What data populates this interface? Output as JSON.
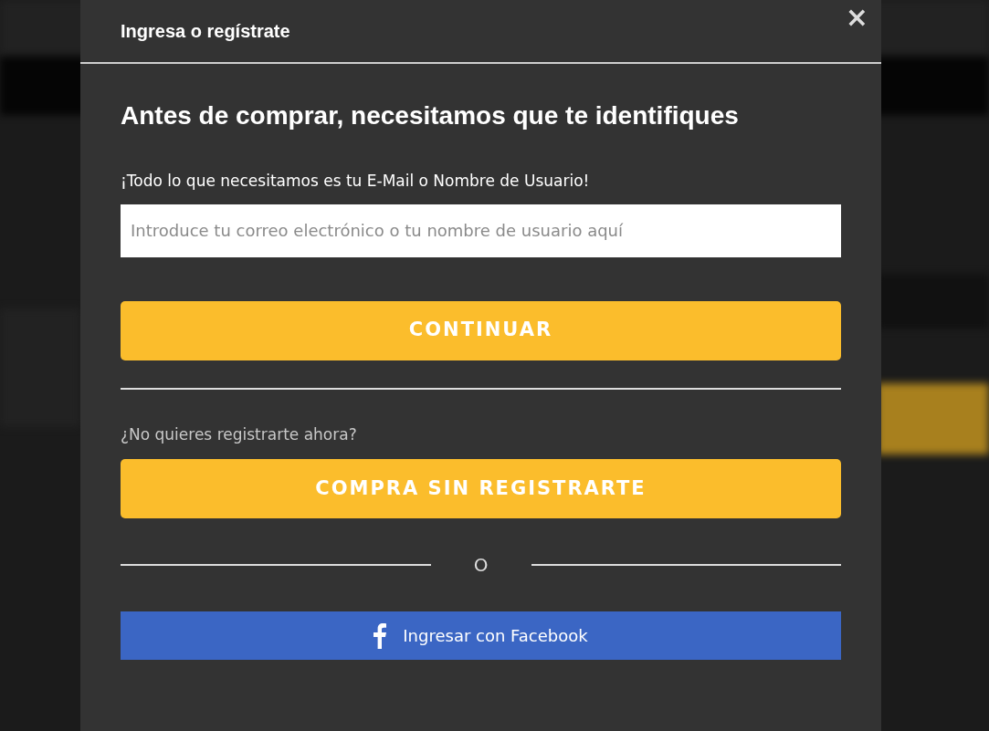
{
  "modal": {
    "title": "Ingresa o regístrate",
    "close": "×",
    "heading": "Antes de comprar, necesitamos que te identifiques",
    "prompt": "¡Todo lo que necesitamos es tu E-Mail o Nombre de Usuario!",
    "field": {
      "placeholder": "Introduce tu correo electrónico o tu nombre de usuario aquí"
    },
    "continue_button": "CONTINUAR",
    "guest_prompt": "¿No quieres registrarte ahora?",
    "guest_button": "COMPRA SIN REGISTRARTE",
    "separator": "O",
    "facebook_button": "Ingresar con Facebook"
  }
}
